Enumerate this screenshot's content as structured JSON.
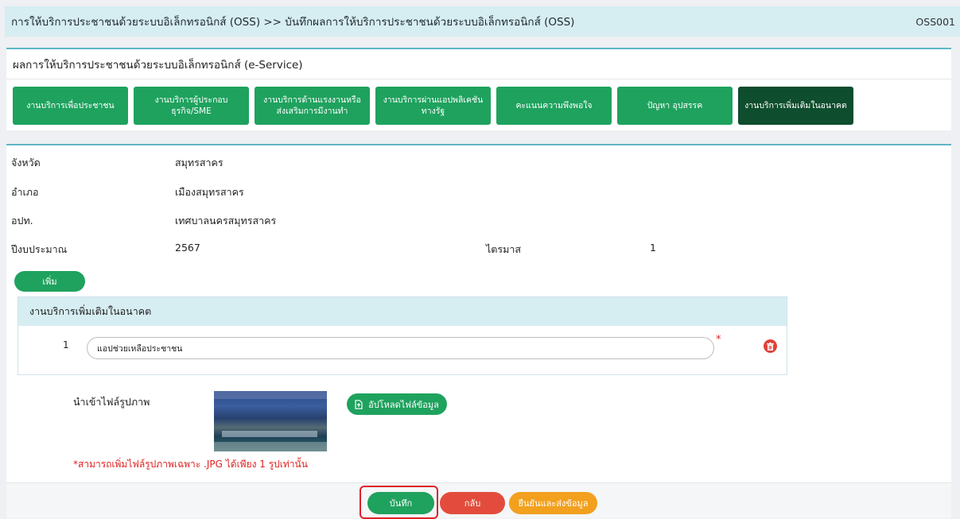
{
  "breadcrumb": {
    "text": "การให้บริการประชาชนด้วยระบบอิเล็กทรอนิกส์ (OSS) >>  บันทึกผลการให้บริการประชาชนด้วยระบบอิเล็กทรอนิกส์ (OSS)",
    "code": "OSS001"
  },
  "section_title": "ผลการให้บริการประชาชนด้วยระบบอิเล็กทรอนิกส์ (e-Service)",
  "tabs": [
    {
      "label": "งานบริการเพื่อประชาชน"
    },
    {
      "label": "งานบริการผู้ประกอบธุรกิจ/SME"
    },
    {
      "label": "งานบริการด้านแรงงานหรือส่งเสริมการมีงานทำ"
    },
    {
      "label": "งานบริการผ่านแอปพลิเคชันทางรัฐ"
    },
    {
      "label": "คะแนนความพึงพอใจ"
    },
    {
      "label": "ปัญหา อุปสรรค"
    },
    {
      "label": "งานบริการเพิ่มเติมในอนาคต"
    }
  ],
  "info": {
    "province_label": "จังหวัด",
    "province_value": "สมุทรสาคร",
    "district_label": "อำเภอ",
    "district_value": "เมืองสมุทรสาคร",
    "lao_label": "อปท.",
    "lao_value": "เทศบาลนครสมุทรสาคร",
    "budget_year_label": "ปีงบประมาณ",
    "budget_year_value": "2567",
    "quarter_label": "ไตรมาส",
    "quarter_value": "1"
  },
  "add_button": "เพิ่ม",
  "panel": {
    "header": "งานบริการเพิ่มเติมในอนาคต",
    "row_number": "1",
    "input_value": "แอปช่วยเหลือประชาชน",
    "required_mark": "*"
  },
  "image_upload": {
    "label": "นำเข้าไฟล์รูปภาพ",
    "upload_button": "อัปโหลดไฟล์ข้อมูล",
    "note": "*สามารถเพิ่มไฟล์รูปภาพเฉพาะ .JPG ได้เพียง 1 รูปเท่านั้น"
  },
  "footer": {
    "save": "บันทึก",
    "back": "กลับ",
    "confirm": "ยืนยันและส่งข้อมูล"
  },
  "colors": {
    "primary_green": "#1fa25e",
    "active_tab": "#0e4d2d",
    "danger": "#e34c3c",
    "warning": "#f2a01e",
    "header_bg": "#d6edf2"
  }
}
